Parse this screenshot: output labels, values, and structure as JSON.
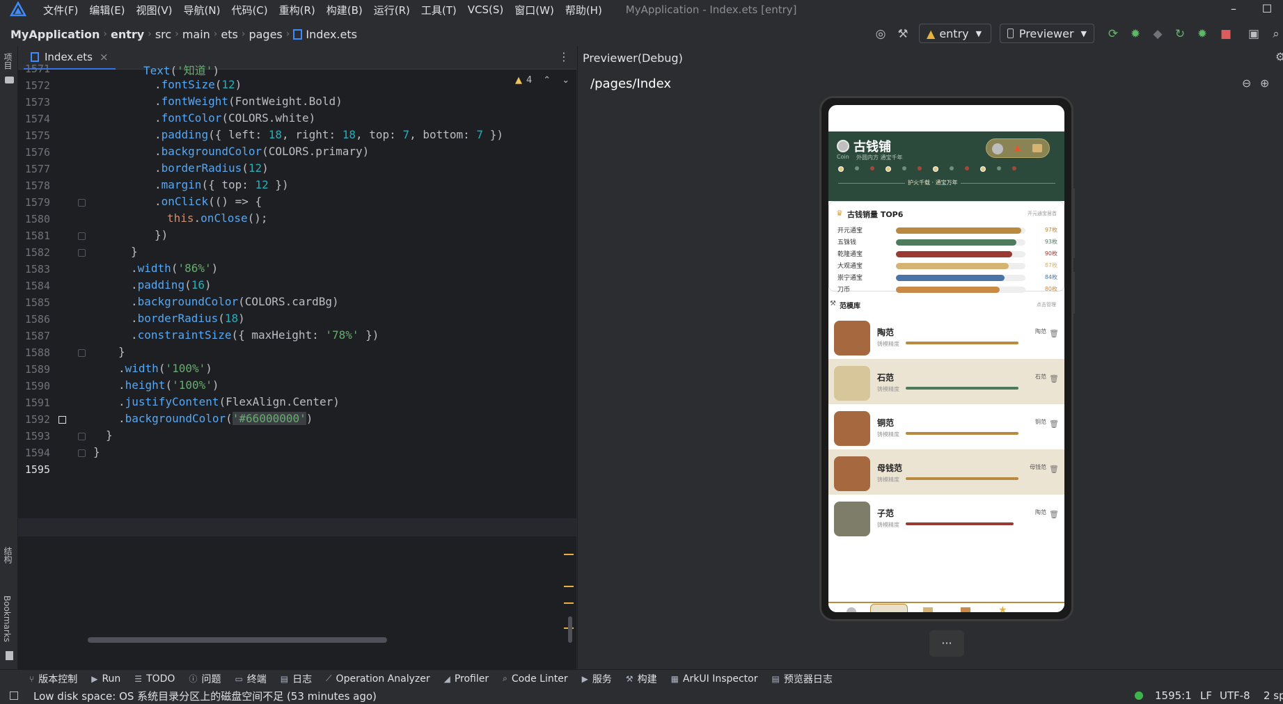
{
  "menubar": {
    "items": [
      "文件(F)",
      "编辑(E)",
      "视图(V)",
      "导航(N)",
      "代码(C)",
      "重构(R)",
      "构建(B)",
      "运行(R)",
      "工具(T)",
      "VCS(S)",
      "窗口(W)",
      "帮助(H)"
    ],
    "title": "MyApplication - Index.ets [entry]"
  },
  "navbar": {
    "crumbs": [
      "MyApplication",
      "entry",
      "src",
      "main",
      "ets",
      "pages",
      "Index.ets"
    ],
    "module": "entry",
    "device": "Previewer"
  },
  "sidebar": {
    "project": "项目",
    "structure": "结构",
    "bookmarks": "Bookmarks"
  },
  "editor": {
    "tab": "Index.ets",
    "warnings": "4",
    "lines": [
      {
        "n": "1571",
        "code": "Text('知道')"
      },
      {
        "n": "1572",
        "code": ".fontSize(12)"
      },
      {
        "n": "1573",
        "code": ".fontWeight(FontWeight.Bold)"
      },
      {
        "n": "1574",
        "code": ".fontColor(COLORS.white)"
      },
      {
        "n": "1575",
        "code": ".padding({ left: 18, right: 18, top: 7, bottom: 7 })"
      },
      {
        "n": "1576",
        "code": ".backgroundColor(COLORS.primary)"
      },
      {
        "n": "1577",
        "code": ".borderRadius(12)"
      },
      {
        "n": "1578",
        "code": ".margin({ top: 12 })"
      },
      {
        "n": "1579",
        "code": ".onClick(() => {"
      },
      {
        "n": "1580",
        "code": "this.onClose();"
      },
      {
        "n": "1581",
        "code": "})"
      },
      {
        "n": "1582",
        "code": "}"
      },
      {
        "n": "1583",
        "code": ".width('86%')"
      },
      {
        "n": "1584",
        "code": ".padding(16)"
      },
      {
        "n": "1585",
        "code": ".backgroundColor(COLORS.cardBg)"
      },
      {
        "n": "1586",
        "code": ".borderRadius(18)"
      },
      {
        "n": "1587",
        "code": ".constraintSize({ maxHeight: '78%' })"
      },
      {
        "n": "1588",
        "code": "}"
      },
      {
        "n": "1589",
        "code": ".width('100%')"
      },
      {
        "n": "1590",
        "code": ".height('100%')"
      },
      {
        "n": "1591",
        "code": ".justifyContent(FlexAlign.Center)"
      },
      {
        "n": "1592",
        "code": ".backgroundColor('#66000000')"
      },
      {
        "n": "1593",
        "code": "}"
      },
      {
        "n": "1594",
        "code": "}"
      },
      {
        "n": "1595",
        "code": ""
      }
    ]
  },
  "previewer": {
    "title": "Previewer(Debug)",
    "route": "/pages/Index",
    "more": "···"
  },
  "app": {
    "shop_name": "古钱铺",
    "coin_label": "Coin",
    "slogan": "外圆内方 通宝千年",
    "furnace_text": "护火千载 · 通宝万年",
    "ranking_title": "古钱销量 TOP6",
    "ranking_subtitle": "开元通宝居首",
    "ranking": [
      {
        "name": "开元通宝",
        "value": "97枚",
        "ratio": 0.97,
        "color": "#b8893f"
      },
      {
        "name": "五铢钱",
        "value": "93枚",
        "ratio": 0.93,
        "color": "#4e7a5e"
      },
      {
        "name": "乾隆通宝",
        "value": "90枚",
        "ratio": 0.9,
        "color": "#9b3a30"
      },
      {
        "name": "大观通宝",
        "value": "87枚",
        "ratio": 0.87,
        "color": "#d5b473"
      },
      {
        "name": "崇宁通宝",
        "value": "84枚",
        "ratio": 0.84,
        "color": "#4a73a8"
      },
      {
        "name": "刀币",
        "value": "80枚",
        "ratio": 0.8,
        "color": "#c98a48"
      }
    ],
    "mold_title": "范模库",
    "mold_hint": "点击管理",
    "molds": [
      {
        "name": "陶范",
        "sub": "铸模精度",
        "tag": "陶范",
        "bar": "#b8893f",
        "bg": "#ffffff",
        "icon_bg": "#a5683f"
      },
      {
        "name": "石范",
        "sub": "铸模精度",
        "tag": "石范",
        "bar": "#4e7a5e",
        "bg": "#ece4d3",
        "icon_bg": "#d6c69a"
      },
      {
        "name": "铜范",
        "sub": "铸模精度",
        "tag": "铜范",
        "bar": "#b8893f",
        "bg": "#ffffff",
        "icon_bg": "#a5683f"
      },
      {
        "name": "母钱范",
        "sub": "铸模精度",
        "tag": "母钱范",
        "bar": "#b8893f",
        "bg": "#ece4d3",
        "icon_bg": "#a5683f"
      },
      {
        "name": "子范",
        "sub": "铸模精度",
        "tag": "陶范",
        "bar": "#9b3a30",
        "bg": "#ffffff",
        "icon_bg": "#7d7d6a"
      }
    ]
  },
  "bottom_tools": [
    "版本控制",
    "Run",
    "TODO",
    "问题",
    "终端",
    "日志",
    "Operation Analyzer",
    "Profiler",
    "Code Linter",
    "服务",
    "构建",
    "ArkUI Inspector",
    "预览器日志"
  ],
  "status": {
    "message": "Low disk space: OS 系统目录分区上的磁盘空间不足 (53 minutes ago)",
    "position": "1595:1",
    "line_ending": "LF",
    "encoding": "UTF-8",
    "indent": "2 sp"
  }
}
